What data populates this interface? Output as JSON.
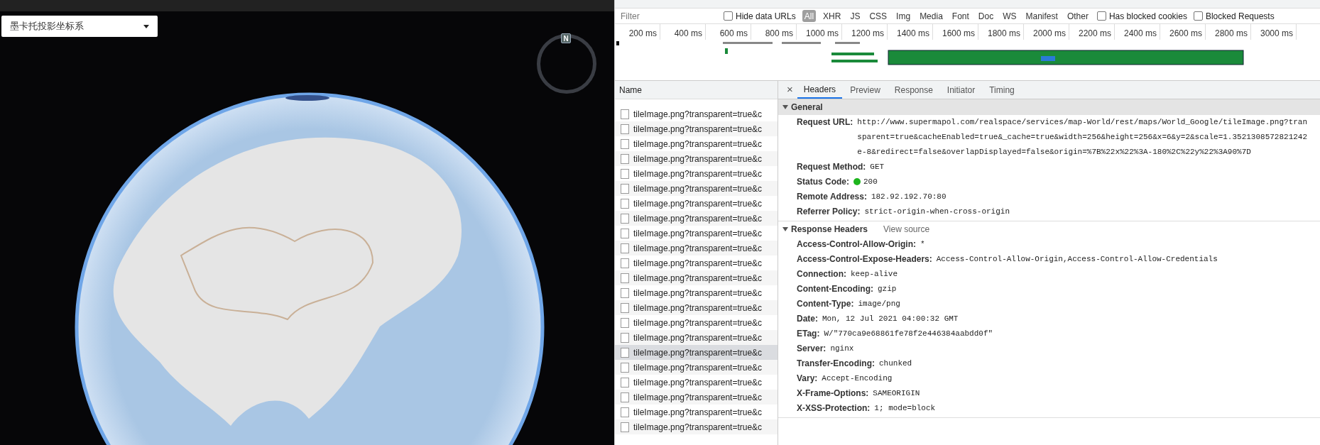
{
  "map": {
    "projection_dropdown": "墨卡托投影坐标系",
    "compass_label": "N"
  },
  "devtools": {
    "filter": {
      "placeholder": "Filter"
    },
    "hide_data_urls": {
      "label": "Hide data URLs",
      "checked": false
    },
    "type_filters": [
      {
        "label": "All",
        "selected": true
      },
      {
        "label": "XHR",
        "selected": false
      },
      {
        "label": "JS",
        "selected": false
      },
      {
        "label": "CSS",
        "selected": false
      },
      {
        "label": "Img",
        "selected": false
      },
      {
        "label": "Media",
        "selected": false
      },
      {
        "label": "Font",
        "selected": false
      },
      {
        "label": "Doc",
        "selected": false
      },
      {
        "label": "WS",
        "selected": false
      },
      {
        "label": "Manifest",
        "selected": false
      },
      {
        "label": "Other",
        "selected": false
      }
    ],
    "has_blocked_cookies": {
      "label": "Has blocked cookies",
      "checked": false
    },
    "blocked_requests": {
      "label": "Blocked Requests",
      "checked": false
    },
    "timeline_ticks": [
      "200 ms",
      "400 ms",
      "600 ms",
      "800 ms",
      "1000 ms",
      "1200 ms",
      "1400 ms",
      "1600 ms",
      "1800 ms",
      "2000 ms",
      "2200 ms",
      "2400 ms",
      "2600 ms",
      "2800 ms",
      "3000 ms"
    ],
    "name_column": "Name",
    "requests": [
      {
        "name": "tileImage.png?transparent=true&c",
        "selected": false
      },
      {
        "name": "tileImage.png?transparent=true&c",
        "selected": false
      },
      {
        "name": "tileImage.png?transparent=true&c",
        "selected": false
      },
      {
        "name": "tileImage.png?transparent=true&c",
        "selected": false
      },
      {
        "name": "tileImage.png?transparent=true&c",
        "selected": false
      },
      {
        "name": "tileImage.png?transparent=true&c",
        "selected": false
      },
      {
        "name": "tileImage.png?transparent=true&c",
        "selected": false
      },
      {
        "name": "tileImage.png?transparent=true&c",
        "selected": false
      },
      {
        "name": "tileImage.png?transparent=true&c",
        "selected": false
      },
      {
        "name": "tileImage.png?transparent=true&c",
        "selected": false
      },
      {
        "name": "tileImage.png?transparent=true&c",
        "selected": false
      },
      {
        "name": "tileImage.png?transparent=true&c",
        "selected": false
      },
      {
        "name": "tileImage.png?transparent=true&c",
        "selected": false
      },
      {
        "name": "tileImage.png?transparent=true&c",
        "selected": false
      },
      {
        "name": "tileImage.png?transparent=true&c",
        "selected": false
      },
      {
        "name": "tileImage.png?transparent=true&c",
        "selected": false
      },
      {
        "name": "tileImage.png?transparent=true&c",
        "selected": true
      },
      {
        "name": "tileImage.png?transparent=true&c",
        "selected": false
      },
      {
        "name": "tileImage.png?transparent=true&c",
        "selected": false
      },
      {
        "name": "tileImage.png?transparent=true&c",
        "selected": false
      },
      {
        "name": "tileImage.png?transparent=true&c",
        "selected": false
      },
      {
        "name": "tileImage.png?transparent=true&c",
        "selected": false
      }
    ],
    "close_symbol": "×",
    "detail_tabs": [
      {
        "label": "Headers",
        "selected": true
      },
      {
        "label": "Preview",
        "selected": false
      },
      {
        "label": "Response",
        "selected": false
      },
      {
        "label": "Initiator",
        "selected": false
      },
      {
        "label": "Timing",
        "selected": false
      }
    ],
    "sections": [
      {
        "title": "General",
        "expanded": true,
        "rows": [
          {
            "kind": "plain",
            "key": "Request URL:",
            "value": "http://www.supermapol.com/realspace/services/map-World/rest/maps/World_Google/tileImage.png?transparent=true&cacheEnabled=true&_cache=true&width=256&height=256&x=6&y=2&scale=1.3521308572821242e-8&redirect=false&overlapDisplayed=false&origin=%7B%22x%22%3A-180%2C%22y%22%3A90%7D"
          },
          {
            "kind": "plain",
            "key": "Request Method:",
            "value": "GET"
          },
          {
            "kind": "status",
            "key": "Status Code:",
            "value": "200"
          },
          {
            "kind": "plain",
            "key": "Remote Address:",
            "value": "182.92.192.70:80"
          },
          {
            "kind": "plain",
            "key": "Referrer Policy:",
            "value": "strict-origin-when-cross-origin"
          }
        ]
      },
      {
        "title": "Response Headers",
        "expanded": true,
        "link": "View source",
        "rows": [
          {
            "kind": "plain",
            "key": "Access-Control-Allow-Origin:",
            "value": "*"
          },
          {
            "kind": "plain",
            "key": "Access-Control-Expose-Headers:",
            "value": "Access-Control-Allow-Origin,Access-Control-Allow-Credentials"
          },
          {
            "kind": "plain",
            "key": "Connection:",
            "value": "keep-alive"
          },
          {
            "kind": "plain",
            "key": "Content-Encoding:",
            "value": "gzip"
          },
          {
            "kind": "plain",
            "key": "Content-Type:",
            "value": "image/png"
          },
          {
            "kind": "plain",
            "key": "Date:",
            "value": "Mon, 12 Jul 2021 04:00:32 GMT"
          },
          {
            "kind": "plain",
            "key": "ETag:",
            "value": "W/\"770ca9e68861fe78f2e446384aabdd0f\""
          },
          {
            "kind": "plain",
            "key": "Server:",
            "value": "nginx"
          },
          {
            "kind": "plain",
            "key": "Transfer-Encoding:",
            "value": "chunked"
          },
          {
            "kind": "plain",
            "key": "Vary:",
            "value": "Accept-Encoding"
          },
          {
            "kind": "plain",
            "key": "X-Frame-Options:",
            "value": "SAMEORIGIN"
          },
          {
            "kind": "plain",
            "key": "X-XSS-Protection:",
            "value": "1; mode=block"
          }
        ]
      }
    ]
  }
}
